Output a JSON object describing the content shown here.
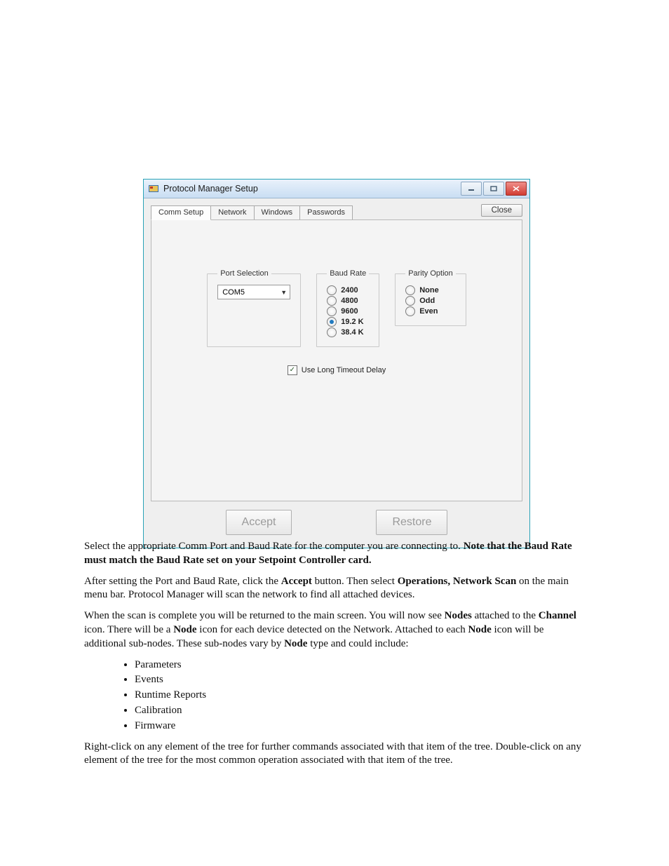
{
  "dialog": {
    "title": "Protocol Manager Setup",
    "close_btn": "Close",
    "tabs": [
      "Comm Setup",
      "Network",
      "Windows",
      "Passwords"
    ],
    "active_tab": 0,
    "port_group_label": "Port Selection",
    "port_value": "COM5",
    "baud_group_label": "Baud Rate",
    "baud_options": [
      "2400",
      "4800",
      "9600",
      "19.2 K",
      "38.4 K"
    ],
    "baud_selected_index": 3,
    "parity_group_label": "Parity Option",
    "parity_options": [
      "None",
      "Odd",
      "Even"
    ],
    "parity_selected_index": -1,
    "timeout_label": "Use Long Timeout Delay",
    "timeout_checked": true,
    "accept_label": "Accept",
    "restore_label": "Restore"
  },
  "doc": {
    "p1": "Select the appropriate Comm Port and Baud Rate for the computer you are connecting to. ",
    "p1_bold": "Note that the Baud Rate must match the Baud Rate set on your Setpoint Controller card.",
    "p2_a": "After setting the Port and Baud Rate, click the ",
    "p2_b": "Accept",
    "p2_c": " button. Then select ",
    "p2_d": "Operations, Network Scan",
    "p2_e": " on the main menu bar. Protocol Manager will scan the network to find all attached devices.",
    "p3_a": "When the scan is complete you will be returned to the main screen. You will now see ",
    "p3_b": "Nodes",
    "p3_c": " attached to the ",
    "p3_d": "Channel",
    "p3_e": " icon. There will be a ",
    "p3_f": "Node",
    "p3_g": " icon for each device detected on the Network. Attached to each ",
    "p3_h": "Node",
    "p3_i": " icon will be additional sub-nodes. These sub-nodes vary by ",
    "p3_j": "Node",
    "p3_k": " type and could include:",
    "bullets": [
      "Parameters",
      "Events",
      "Runtime Reports",
      "Calibration",
      "Firmware"
    ],
    "p4": "Right-click on any element of the tree for further commands associated with that item of the tree. Double-click on any element of the tree for the most common operation associated with that item of the tree."
  }
}
